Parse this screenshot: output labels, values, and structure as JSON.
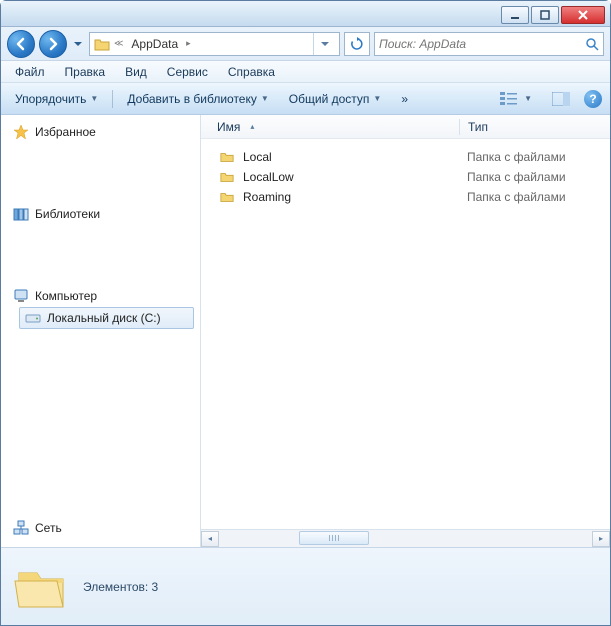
{
  "titlebar": {
    "title": ""
  },
  "nav": {
    "breadcrumb_segments": [
      "AppData"
    ],
    "search_placeholder": "Поиск: AppData"
  },
  "menubar": {
    "items": [
      "Файл",
      "Правка",
      "Вид",
      "Сервис",
      "Справка"
    ]
  },
  "toolbar": {
    "organize": "Упорядочить",
    "add_library": "Добавить в библиотеку",
    "share": "Общий доступ",
    "overflow": "»"
  },
  "sidebar": {
    "favorites": {
      "label": "Избранное"
    },
    "libraries": {
      "label": "Библиотеки"
    },
    "computer": {
      "label": "Компьютер",
      "children": [
        {
          "label": "Локальный диск (C:)",
          "selected": true
        }
      ]
    },
    "network": {
      "label": "Сеть"
    }
  },
  "columns": {
    "name": "Имя",
    "type": "Тип"
  },
  "files": [
    {
      "name": "Local",
      "type": "Папка с файлами"
    },
    {
      "name": "LocalLow",
      "type": "Папка с файлами"
    },
    {
      "name": "Roaming",
      "type": "Папка с файлами"
    }
  ],
  "statusbar": {
    "elements_label": "Элементов: 3"
  }
}
